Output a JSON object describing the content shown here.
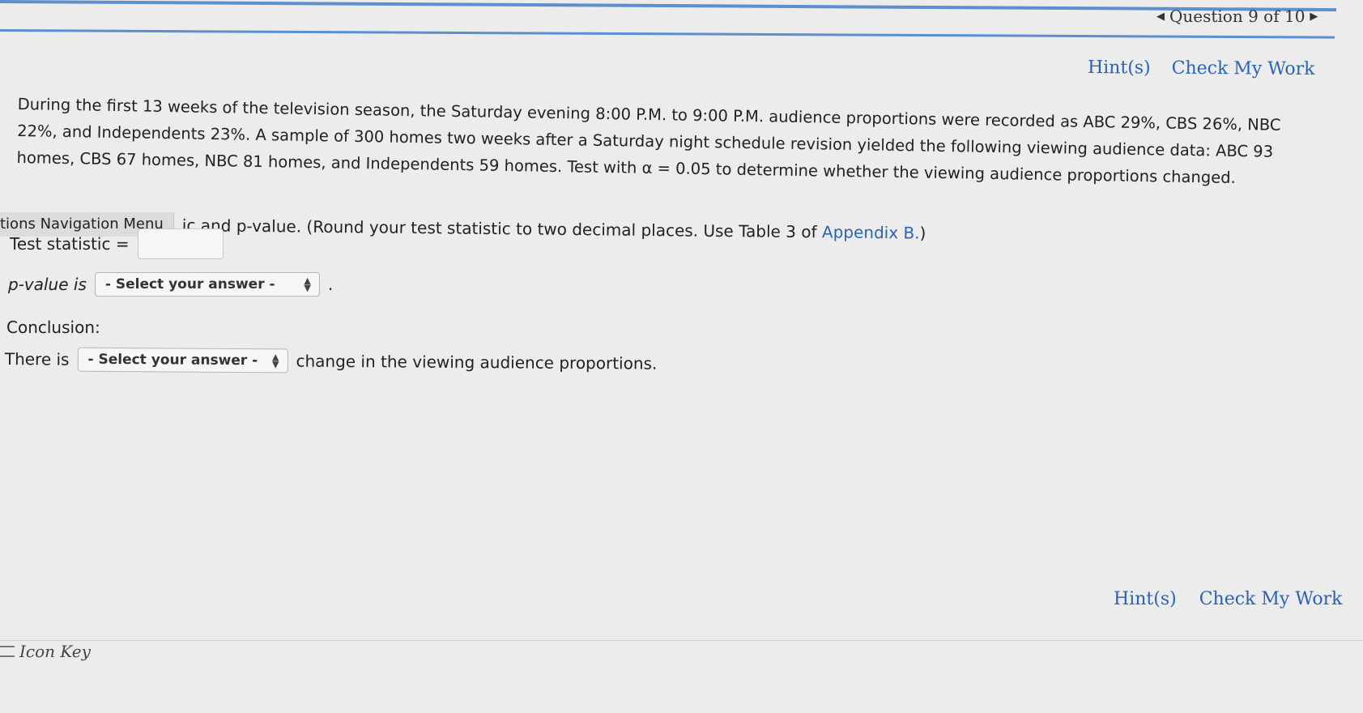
{
  "nav": {
    "question_indicator": "Question 9 of 10",
    "prev_arrow": "◀",
    "next_arrow": "▶"
  },
  "links_top": {
    "hints": "Hint(s)",
    "check": "Check My Work"
  },
  "links_bottom": {
    "hints": "Hint(s)",
    "check": "Check My Work"
  },
  "problem": {
    "text": "During the first 13 weeks of the television season, the Saturday evening 8:00 P.M. to 9:00 P.M. audience proportions were recorded as ABC 29%, CBS 26%, NBC 22%, and Independents 23%. A sample of 300 homes two weeks after a Saturday night schedule revision yielded the following viewing audience data: ABC 93 homes, CBS 67 homes, NBC 81 homes, and Independents 59 homes. Test with α = 0.05 to determine whether the viewing audience proportions changed."
  },
  "nav_menu_label": "tions Navigation Menu",
  "instructions": {
    "text": "ic and p-value. (Round your test statistic to two decimal places. Use Table 3 of ",
    "appendix_link": "Appendix B.",
    "close": ")"
  },
  "form": {
    "test_statistic_label": "Test statistic =",
    "test_statistic_value": "",
    "pvalue_label": "p-value is",
    "pvalue_select": "- Select your answer -",
    "pvalue_tail": ".",
    "conclusion_label": "Conclusion:",
    "there_is_label": "There is",
    "conclusion_select": "- Select your answer -",
    "conclusion_tail": "change in the viewing audience proportions."
  },
  "footer": {
    "icon_key": "Icon Key"
  },
  "colors": {
    "accent_blue": "#2a62b6",
    "rule_blue": "#5b8fd1",
    "background": "#ececec"
  }
}
